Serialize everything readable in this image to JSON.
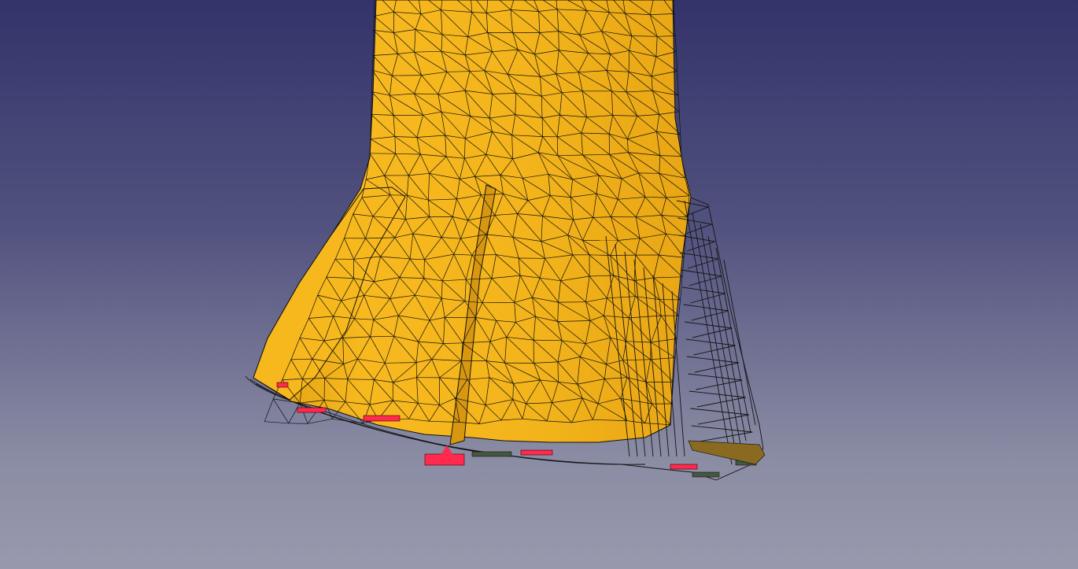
{
  "viewport": {
    "background_top": "#33336a",
    "background_bottom": "#9899ad"
  },
  "model": {
    "mesh_face_color": "#f4b51c",
    "mesh_face_shade": "#e6a311",
    "mesh_edge_color": "#111111",
    "wireframe_color": "#141414",
    "constraint_color": "#ff2a4d",
    "constraint_secondary_color": "#3d5a44",
    "load_color": "#8a6a20"
  }
}
